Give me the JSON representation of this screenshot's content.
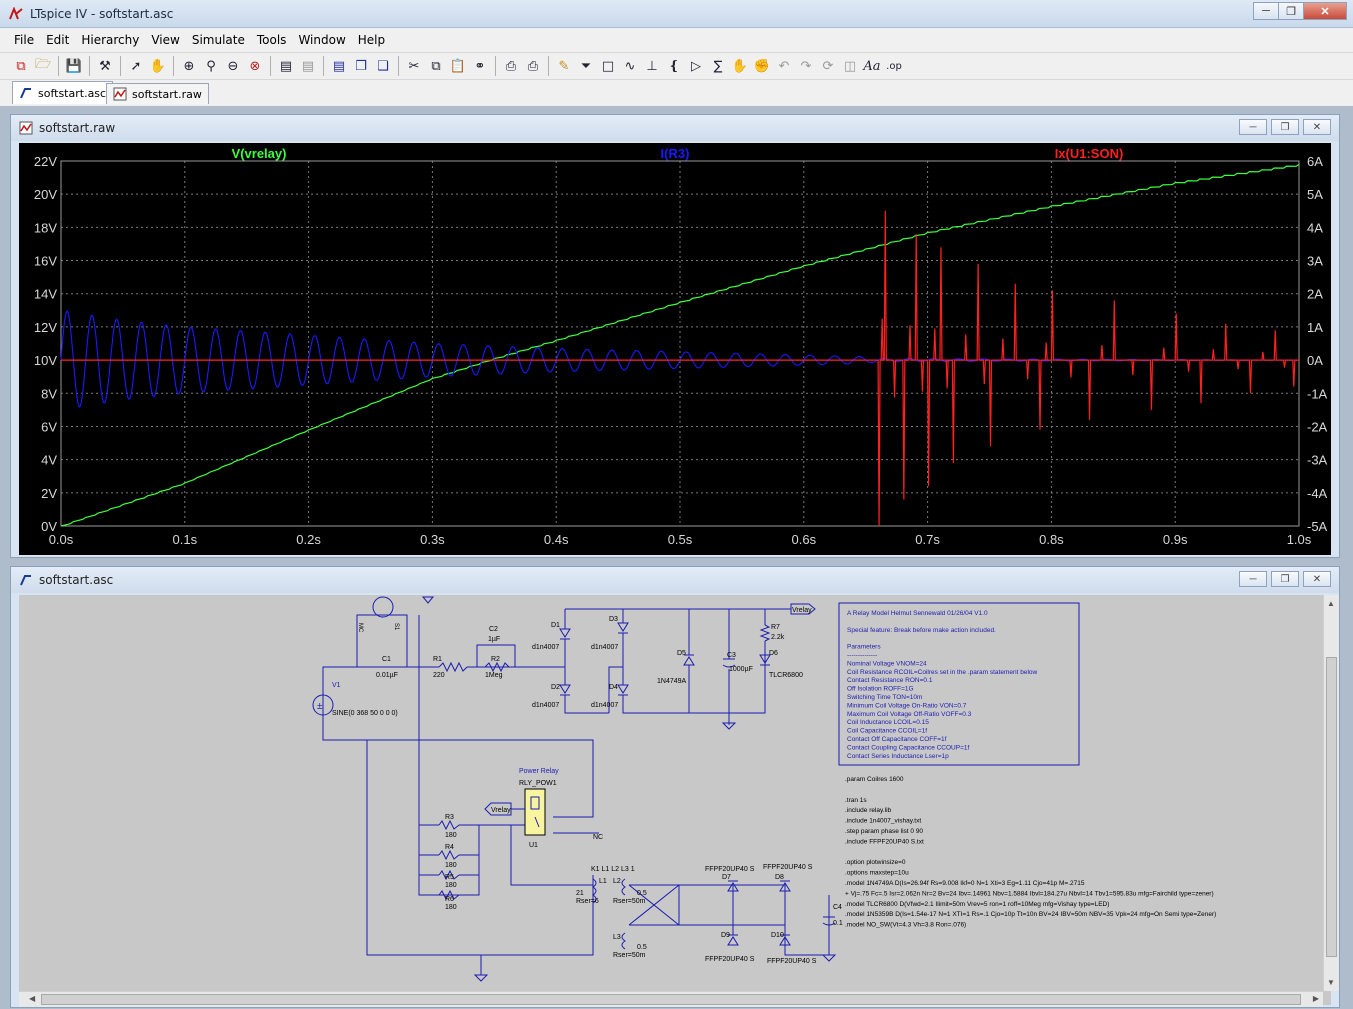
{
  "window": {
    "title": "LTspice IV - softstart.asc"
  },
  "menu": [
    "File",
    "Edit",
    "Hierarchy",
    "View",
    "Simulate",
    "Tools",
    "Window",
    "Help"
  ],
  "tabs": [
    {
      "label": "softstart.asc",
      "active": true,
      "icon": "schematic-icon"
    },
    {
      "label": "softstart.raw",
      "active": false,
      "icon": "waveform-icon"
    }
  ],
  "waveform_window": {
    "title": "softstart.raw",
    "traces": [
      {
        "label": "V(vrelay)",
        "color": "#3dff3d"
      },
      {
        "label": "I(R3)",
        "color": "#1a1aff"
      },
      {
        "label": "Ix(U1:SON)",
        "color": "#ff2020"
      }
    ]
  },
  "chart_data": {
    "type": "line",
    "background": "#000000",
    "grid": true,
    "x_ticks": [
      "0.0s",
      "0.1s",
      "0.2s",
      "0.3s",
      "0.4s",
      "0.5s",
      "0.6s",
      "0.7s",
      "0.8s",
      "0.9s",
      "1.0s"
    ],
    "y_left_ticks": [
      "22V",
      "20V",
      "18V",
      "16V",
      "14V",
      "12V",
      "10V",
      "8V",
      "6V",
      "4V",
      "2V",
      "0V"
    ],
    "y_right_ticks": [
      "6A",
      "5A",
      "4A",
      "3A",
      "2A",
      "1A",
      "0A",
      "-1A",
      "-2A",
      "-3A",
      "-4A",
      "-5A"
    ],
    "xlim": [
      0,
      1.0
    ],
    "ylim_left": [
      0,
      22
    ],
    "ylim_right": [
      -5,
      6
    ],
    "series": [
      {
        "name": "V(vrelay)",
        "axis": "left",
        "color": "#3dff3d",
        "x": [
          0,
          0.1,
          0.2,
          0.3,
          0.35,
          0.4,
          0.5,
          0.6,
          0.7,
          0.8,
          0.9,
          1.0
        ],
        "y": [
          0,
          2.6,
          5.8,
          8.9,
          10.1,
          11.2,
          13.5,
          15.7,
          17.7,
          19.3,
          20.7,
          21.8
        ]
      },
      {
        "name": "I(R3)",
        "axis": "right",
        "color": "#1a1aff",
        "x": [
          0,
          0.05,
          0.1,
          0.2,
          0.3,
          0.4,
          0.5,
          0.6,
          0.65,
          0.66,
          1.0
        ],
        "y": [
          1.5,
          1.2,
          1.0,
          0.75,
          0.5,
          0.35,
          0.25,
          0.15,
          0.1,
          0.05,
          0.0
        ]
      },
      {
        "name": "Ix(U1:SON)",
        "axis": "right",
        "color": "#ff2020",
        "x": [
          0.66,
          0.665,
          0.68,
          0.69,
          0.7,
          0.71,
          0.72,
          0.74,
          0.75,
          0.77,
          0.79,
          0.8,
          0.83,
          0.85,
          0.88,
          0.9,
          0.92,
          0.94,
          0.96,
          0.98,
          0.995
        ],
        "y": [
          -5.0,
          4.5,
          -4.2,
          3.8,
          -3.8,
          3.4,
          -3.1,
          2.9,
          -2.6,
          2.3,
          -2.1,
          2.1,
          -1.8,
          1.8,
          -1.5,
          1.4,
          -1.3,
          1.1,
          -1.0,
          0.9,
          -0.8
        ]
      }
    ]
  },
  "schematic_window": {
    "title": "softstart.asc",
    "components": {
      "V1": "V1",
      "V1_value": "SINE(0 368 50 0 0 0)",
      "C1": "C1",
      "C1_value": "0.01µF",
      "R1": "R1",
      "R1_value": "220",
      "C2": "C2",
      "C2_value": "1µF",
      "R2": "R2",
      "R2_value": "1Meg",
      "D1": "D1",
      "D1_value": "d1n4007",
      "D2": "D2",
      "D2_value": "d1n4007",
      "D3": "D3",
      "D3_value": "d1n4007",
      "D4": "D4",
      "D4_value": "d1n4007",
      "D5": "D5",
      "D5_value": "1N4749A",
      "C3": "C3",
      "C3_value": "1000µF",
      "R7": "R7",
      "R7_value": "2.2k",
      "D6": "D6",
      "D6_value": "TLCR6800",
      "vrelay": "Vrelay",
      "relay_title": "Power Relay",
      "relay_name": "RLY_POW1",
      "U1": "U1",
      "NC": "NC",
      "R3": "R3",
      "R3_value": "180",
      "R4": "R4",
      "R4_value": "180",
      "R5": "R5",
      "R5_value": "180",
      "R6": "R6",
      "R6_value": "180",
      "K1": "K1 L1 L2 L3 1",
      "L1": "L1",
      "L1_value": "21",
      "L1_rser": "Rser=6",
      "L2": "L2",
      "L2_value": "0.5",
      "L2_rser": "Rser=50m",
      "L3": "L3",
      "L3_value": "0.5",
      "L3_rser": "Rser=50m",
      "D7": "D7",
      "D8": "D8",
      "D9": "D9",
      "D10": "D10",
      "D_value": "FFPF20UP40 S",
      "C4": "C4",
      "C4_value": "0.1",
      "mc": "MC",
      "s1": "S1"
    },
    "model_box": [
      "A Relay Model          Helmut Sennewald       01/26/04  V1.0",
      "",
      "Special feature: Break before make action included.",
      "",
      "Parameters",
      "--------------",
      "Nominal Voltage  VNOM=24",
      "Coil Resistance   RCOIL=Coilres set in the .param statement below",
      "Contact Resistance  RON=0.1",
      "Off Isolation  ROFF=1G",
      "Switching Time  TON=10m",
      "Minimum Coil Voltage On-Ratio  VON=0.7",
      "Maximum Coil Voltage Off-Ratio  VOFF=0.3",
      "Coil Inductance  LCOIL=0.15",
      "Coil Capacitance  CCOIL=1f",
      "Contact Off Capacitance  COFF=1f",
      "Contact Coupling Capacitance  CCOUP=1f",
      "Contact Series Inductance  Lser=1p"
    ],
    "directives": [
      ".param Coilres 1600",
      "",
      ".tran 1s",
      ".include relay.lib",
      ".include 1n4007_vishay.txt",
      ".step param phase list 0 90",
      ".include FFPF20UP40 S.txt",
      "",
      ".option plotwinsize=0",
      ".options maxstep=10u",
      ".model 1N4749A D(Is=26.94f Rs=9.008 Ikf=0 N=1 Xti=3 Eg=1.11 Cjo=41p M=.2715",
      "+ Vj=.75 Fc=.5 Isr=2.062n Nr=2 Bv=24 Ibv=.14961 Nbv=1.5884 Ibvl=184.27u Nbvl=14 Tbv1=595.83u mfg=Fairchild type=zener)",
      ".model TLCR6800 D(Vfwd=2.1 Ilimit=50m Vrev=5  ron=1 roff=10Meg mfg=Vishay type=LED)",
      ".model 1N5359B D(Is=1.54e-17 N=1 XTI=1 Rs=.1 Cjo=10p Tt=10n BV=24 IBV=50m NBV=35 Vpk=24 mfg=On Semi type=Zener)",
      ".model NO_SW(Vt=4.3 Vh=3.8 Ron=.076)"
    ]
  }
}
